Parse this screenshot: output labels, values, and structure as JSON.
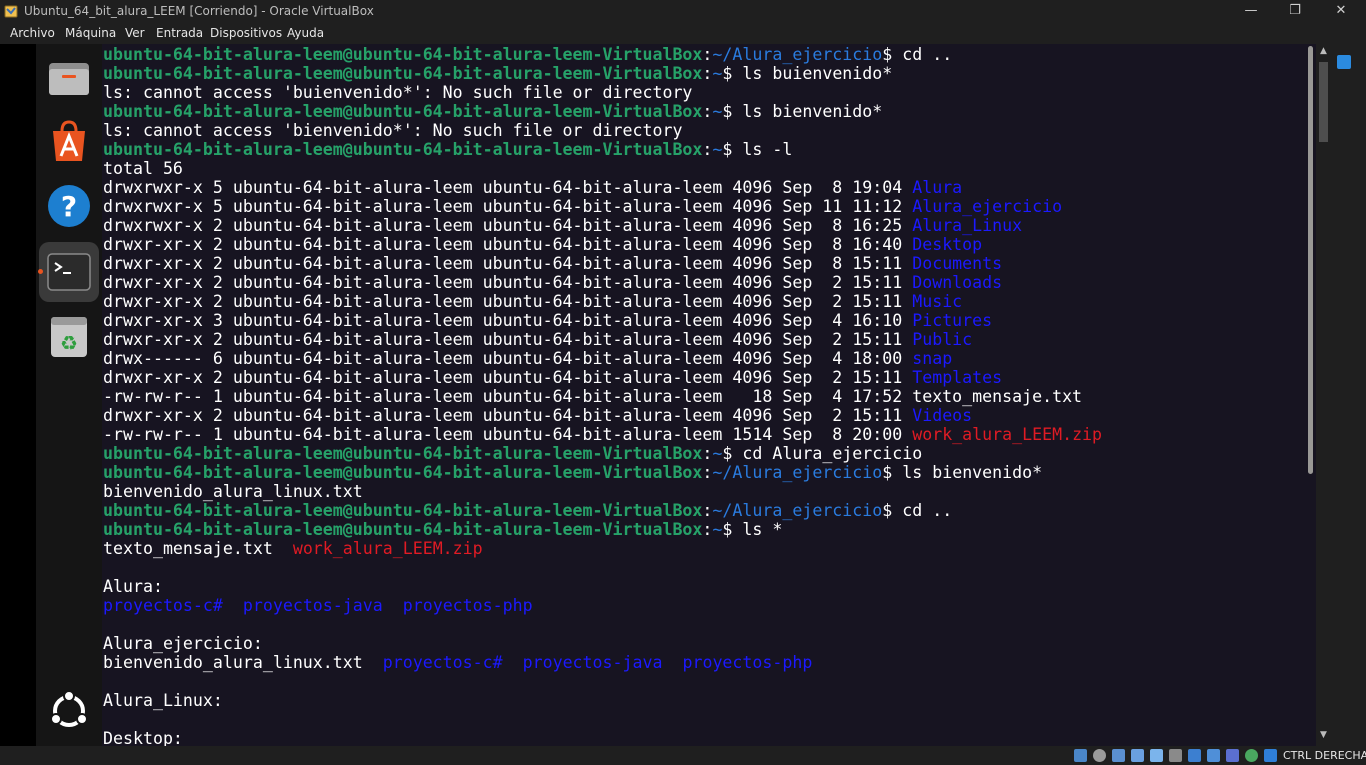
{
  "window": {
    "title": "Ubuntu_64_bit_alura_LEEM [Corriendo] - Oracle VirtualBox",
    "minimize_glyph": "—",
    "restore_glyph": "❐",
    "close_glyph": "✕"
  },
  "menu": [
    "Archivo",
    "Máquina",
    "Ver",
    "Entrada",
    "Dispositivos",
    "Ayuda"
  ],
  "dock": {
    "items": [
      "files-icon",
      "app-center-icon",
      "help-icon",
      "terminal-icon",
      "trash-icon"
    ],
    "bottom": "show-apps-icon",
    "active": "terminal-icon"
  },
  "terminal": {
    "prompt_user": "ubuntu-64-bit-alura-leem@ubuntu-64-bit-alura-leem-VirtualBox",
    "lines": [
      [
        {
          "t": "ubuntu-64-bit-alura-leem@ubuntu-64-bit-alura-leem-VirtualBox",
          "c": "pu"
        },
        {
          "t": ":",
          "c": ""
        },
        {
          "t": "~/Alura_ejercicio",
          "c": "pp"
        },
        {
          "t": "$ cd ..",
          "c": ""
        }
      ],
      [
        {
          "t": "ubuntu-64-bit-alura-leem@ubuntu-64-bit-alura-leem-VirtualBox",
          "c": "pu"
        },
        {
          "t": ":",
          "c": ""
        },
        {
          "t": "~",
          "c": "pp"
        },
        {
          "t": "$ ls buienvenido*",
          "c": ""
        }
      ],
      [
        {
          "t": "ls: cannot access 'buienvenido*': No such file or directory",
          "c": ""
        }
      ],
      [
        {
          "t": "ubuntu-64-bit-alura-leem@ubuntu-64-bit-alura-leem-VirtualBox",
          "c": "pu"
        },
        {
          "t": ":",
          "c": ""
        },
        {
          "t": "~",
          "c": "pp"
        },
        {
          "t": "$ ls bienvenido*",
          "c": ""
        }
      ],
      [
        {
          "t": "ls: cannot access 'bienvenido*': No such file or directory",
          "c": ""
        }
      ],
      [
        {
          "t": "ubuntu-64-bit-alura-leem@ubuntu-64-bit-alura-leem-VirtualBox",
          "c": "pu"
        },
        {
          "t": ":",
          "c": ""
        },
        {
          "t": "~",
          "c": "pp"
        },
        {
          "t": "$ ls -l",
          "c": ""
        }
      ],
      [
        {
          "t": "total 56",
          "c": ""
        }
      ],
      [
        {
          "t": "drwxrwxr-x 5 ubuntu-64-bit-alura-leem ubuntu-64-bit-alura-leem 4096 Sep  8 19:04 ",
          "c": ""
        },
        {
          "t": "Alura",
          "c": "dir"
        }
      ],
      [
        {
          "t": "drwxrwxr-x 5 ubuntu-64-bit-alura-leem ubuntu-64-bit-alura-leem 4096 Sep 11 11:12 ",
          "c": ""
        },
        {
          "t": "Alura_ejercicio",
          "c": "dir"
        }
      ],
      [
        {
          "t": "drwxrwxr-x 2 ubuntu-64-bit-alura-leem ubuntu-64-bit-alura-leem 4096 Sep  8 16:25 ",
          "c": ""
        },
        {
          "t": "Alura_Linux",
          "c": "dir"
        }
      ],
      [
        {
          "t": "drwxr-xr-x 2 ubuntu-64-bit-alura-leem ubuntu-64-bit-alura-leem 4096 Sep  8 16:40 ",
          "c": ""
        },
        {
          "t": "Desktop",
          "c": "dir"
        }
      ],
      [
        {
          "t": "drwxr-xr-x 2 ubuntu-64-bit-alura-leem ubuntu-64-bit-alura-leem 4096 Sep  8 15:11 ",
          "c": ""
        },
        {
          "t": "Documents",
          "c": "dir"
        }
      ],
      [
        {
          "t": "drwxr-xr-x 2 ubuntu-64-bit-alura-leem ubuntu-64-bit-alura-leem 4096 Sep  2 15:11 ",
          "c": ""
        },
        {
          "t": "Downloads",
          "c": "dir"
        }
      ],
      [
        {
          "t": "drwxr-xr-x 2 ubuntu-64-bit-alura-leem ubuntu-64-bit-alura-leem 4096 Sep  2 15:11 ",
          "c": ""
        },
        {
          "t": "Music",
          "c": "dir"
        }
      ],
      [
        {
          "t": "drwxr-xr-x 3 ubuntu-64-bit-alura-leem ubuntu-64-bit-alura-leem 4096 Sep  4 16:10 ",
          "c": ""
        },
        {
          "t": "Pictures",
          "c": "dir"
        }
      ],
      [
        {
          "t": "drwxr-xr-x 2 ubuntu-64-bit-alura-leem ubuntu-64-bit-alura-leem 4096 Sep  2 15:11 ",
          "c": ""
        },
        {
          "t": "Public",
          "c": "dir"
        }
      ],
      [
        {
          "t": "drwx------ 6 ubuntu-64-bit-alura-leem ubuntu-64-bit-alura-leem 4096 Sep  4 18:00 ",
          "c": ""
        },
        {
          "t": "snap",
          "c": "dir"
        }
      ],
      [
        {
          "t": "drwxr-xr-x 2 ubuntu-64-bit-alura-leem ubuntu-64-bit-alura-leem 4096 Sep  2 15:11 ",
          "c": ""
        },
        {
          "t": "Templates",
          "c": "dir"
        }
      ],
      [
        {
          "t": "-rw-rw-r-- 1 ubuntu-64-bit-alura-leem ubuntu-64-bit-alura-leem   18 Sep  4 17:52 texto_mensaje.txt",
          "c": ""
        }
      ],
      [
        {
          "t": "drwxr-xr-x 2 ubuntu-64-bit-alura-leem ubuntu-64-bit-alura-leem 4096 Sep  2 15:11 ",
          "c": ""
        },
        {
          "t": "Videos",
          "c": "dir"
        }
      ],
      [
        {
          "t": "-rw-rw-r-- 1 ubuntu-64-bit-alura-leem ubuntu-64-bit-alura-leem 1514 Sep  8 20:00 ",
          "c": ""
        },
        {
          "t": "work_alura_LEEM.zip",
          "c": "zip"
        }
      ],
      [
        {
          "t": "ubuntu-64-bit-alura-leem@ubuntu-64-bit-alura-leem-VirtualBox",
          "c": "pu"
        },
        {
          "t": ":",
          "c": ""
        },
        {
          "t": "~",
          "c": "pp"
        },
        {
          "t": "$ cd Alura_ejercicio",
          "c": ""
        }
      ],
      [
        {
          "t": "ubuntu-64-bit-alura-leem@ubuntu-64-bit-alura-leem-VirtualBox",
          "c": "pu"
        },
        {
          "t": ":",
          "c": ""
        },
        {
          "t": "~/Alura_ejercicio",
          "c": "pp"
        },
        {
          "t": "$ ls bienvenido*",
          "c": ""
        }
      ],
      [
        {
          "t": "bienvenido_alura_linux.txt",
          "c": ""
        }
      ],
      [
        {
          "t": "ubuntu-64-bit-alura-leem@ubuntu-64-bit-alura-leem-VirtualBox",
          "c": "pu"
        },
        {
          "t": ":",
          "c": ""
        },
        {
          "t": "~/Alura_ejercicio",
          "c": "pp"
        },
        {
          "t": "$ cd ..",
          "c": ""
        }
      ],
      [
        {
          "t": "ubuntu-64-bit-alura-leem@ubuntu-64-bit-alura-leem-VirtualBox",
          "c": "pu"
        },
        {
          "t": ":",
          "c": ""
        },
        {
          "t": "~",
          "c": "pp"
        },
        {
          "t": "$ ls *",
          "c": ""
        }
      ],
      [
        {
          "t": "texto_mensaje.txt  ",
          "c": ""
        },
        {
          "t": "work_alura_LEEM.zip",
          "c": "zip"
        }
      ],
      [],
      [
        {
          "t": "Alura:",
          "c": ""
        }
      ],
      [
        {
          "t": "proyectos-c#",
          "c": "dir"
        },
        {
          "t": "  ",
          "c": ""
        },
        {
          "t": "proyectos-java",
          "c": "dir"
        },
        {
          "t": "  ",
          "c": ""
        },
        {
          "t": "proyectos-php",
          "c": "dir"
        }
      ],
      [],
      [
        {
          "t": "Alura_ejercicio:",
          "c": ""
        }
      ],
      [
        {
          "t": "bienvenido_alura_linux.txt  ",
          "c": ""
        },
        {
          "t": "proyectos-c#",
          "c": "dir"
        },
        {
          "t": "  ",
          "c": ""
        },
        {
          "t": "proyectos-java",
          "c": "dir"
        },
        {
          "t": "  ",
          "c": ""
        },
        {
          "t": "proyectos-php",
          "c": "dir"
        }
      ],
      [],
      [
        {
          "t": "Alura_Linux:",
          "c": ""
        }
      ],
      [],
      [
        {
          "t": "Desktop:",
          "c": ""
        }
      ]
    ]
  },
  "statusbar": {
    "host_key": "CTRL DERECHA",
    "icons": [
      "hard-disk-icon",
      "optical-drive-icon",
      "audio-icon",
      "network-icon",
      "usb-icon",
      "shared-folders-icon",
      "display-icon",
      "video-capture-icon",
      "cpu-icon",
      "recording-icon",
      "mouse-integration-icon",
      "keyboard-icon"
    ]
  },
  "colors": {
    "prompt_user": "#26a269",
    "prompt_path": "#2a7bde",
    "directory": "#1c19ff",
    "archive": "#e01b24",
    "terminal_bg": "#171421"
  }
}
